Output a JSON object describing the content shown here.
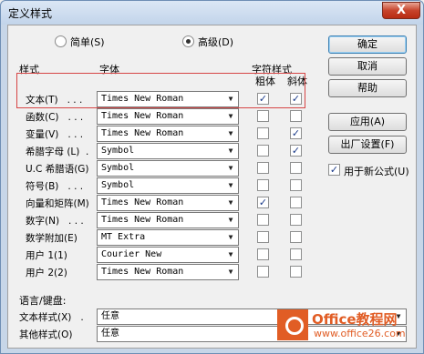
{
  "window": {
    "title": "定义样式",
    "close_glyph": "X"
  },
  "mode": {
    "simple_label": "简单(S)",
    "advanced_label": "高级(D)",
    "selected": "advanced"
  },
  "columns": {
    "style": "样式",
    "font": "字体",
    "char_style": "字符样式",
    "bold": "粗体",
    "italic": "斜体"
  },
  "rows": [
    {
      "label": "文本(T)   . . .",
      "font": "Times New Roman",
      "bold": true,
      "italic": true
    },
    {
      "label": "函数(C)   . . .",
      "font": "Times New Roman",
      "bold": false,
      "italic": false
    },
    {
      "label": "变量(V)   . . .",
      "font": "Times New Roman",
      "bold": false,
      "italic": true
    },
    {
      "label": "希腊字母 (L)  .",
      "font": "Symbol",
      "bold": false,
      "italic": true
    },
    {
      "label": "U.C 希腊语(G)",
      "font": "Symbol",
      "bold": false,
      "italic": false
    },
    {
      "label": "符号(B)   . . .",
      "font": "Symbol",
      "bold": false,
      "italic": false
    },
    {
      "label": "向量和矩阵(M)",
      "font": "Times New Roman",
      "bold": true,
      "italic": false
    },
    {
      "label": "数字(N)   . . .",
      "font": "Times New Roman",
      "bold": false,
      "italic": false
    },
    {
      "label": "数学附加(E)",
      "font": "MT Extra",
      "bold": false,
      "italic": false
    },
    {
      "label": "用户 1(1)",
      "font": "Courier New",
      "bold": false,
      "italic": false
    },
    {
      "label": "用户 2(2)",
      "font": "Times New Roman",
      "bold": false,
      "italic": false
    }
  ],
  "buttons": {
    "ok": "确定",
    "cancel": "取消",
    "help": "帮助",
    "apply": "应用(A)",
    "factory": "出厂设置(F)"
  },
  "use_for_new": {
    "label": "用于新公式(U)",
    "checked": true
  },
  "language": {
    "header": "语言/键盘:",
    "text_style_label": "文本样式(X)   .",
    "text_style_value": "任意",
    "other_style_label": "其他样式(O)",
    "other_style_value": "任意"
  },
  "watermark": {
    "title": "Office教程网",
    "url": "www.office26.com"
  },
  "colors": {
    "accent": "#e15d25",
    "highlight": "#d64545",
    "titlebar": "#c7d6e8"
  }
}
